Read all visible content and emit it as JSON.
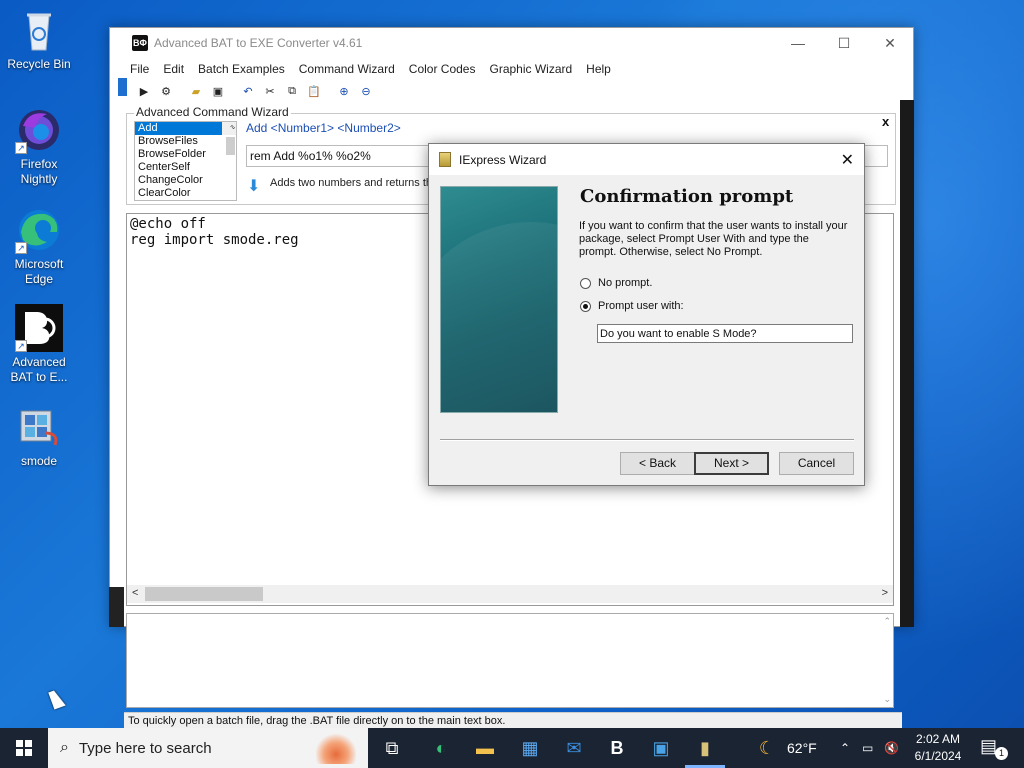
{
  "desktop": {
    "icons": [
      {
        "label": "Recycle Bin",
        "icon": "recycle-bin-icon"
      },
      {
        "label": "Firefox Nightly",
        "icon": "firefox-nightly-icon"
      },
      {
        "label": "Microsoft Edge",
        "icon": "edge-icon"
      },
      {
        "label": "Advanced BAT to E...",
        "icon": "advanced-bat-icon"
      },
      {
        "label": "smode",
        "icon": "registry-file-icon"
      }
    ]
  },
  "app": {
    "title": "Advanced BAT to EXE Converter v4.61",
    "logo_text": "BΦ",
    "menu": [
      "File",
      "Edit",
      "Batch Examples",
      "Command Wizard",
      "Color Codes",
      "Graphic Wizard",
      "Help"
    ],
    "wizard": {
      "legend": "Advanced Command Wizard",
      "commands": [
        "Add",
        "BrowseFiles",
        "BrowseFolder",
        "CenterSelf",
        "ChangeColor",
        "ClearColor"
      ],
      "selected": "Add",
      "syntax": "Add  <Number1> <Number2>",
      "field_value": "rem Add %o1% %o2%",
      "description": "Adds two numbers and returns the"
    },
    "editor_lines": [
      "@echo off",
      "reg import smode.reg"
    ],
    "status": "To quickly open a batch file, drag the .BAT file directly on to the main text box."
  },
  "dialog": {
    "title": "IExpress Wizard",
    "heading": "Confirmation prompt",
    "description": "If you want to confirm that the user wants to install your package, select Prompt User With and type the prompt. Otherwise, select No Prompt.",
    "options": [
      {
        "label": "No prompt.",
        "checked": false
      },
      {
        "label": "Prompt user with:",
        "checked": true
      }
    ],
    "prompt_value": "Do you want to enable S Mode?",
    "buttons": {
      "back": "< Back",
      "next": "Next >",
      "cancel": "Cancel"
    }
  },
  "taskbar": {
    "search_placeholder": "Type here to search",
    "weather_temp": "62°F",
    "time": "2:02 AM",
    "date": "6/1/2024",
    "notification_count": "1",
    "accent": "#7fb4ff"
  }
}
